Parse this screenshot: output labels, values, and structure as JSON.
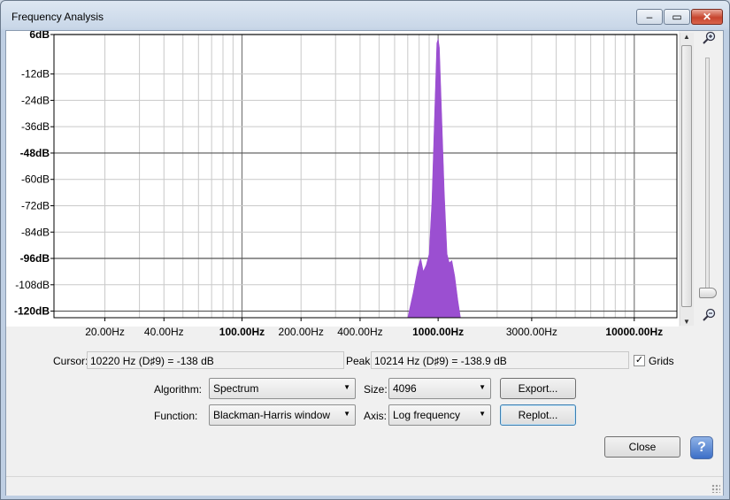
{
  "window": {
    "title": "Frequency Analysis"
  },
  "titlebar_buttons": {
    "minimize": "–",
    "maximize": "▭",
    "close": "✕"
  },
  "chart_data": {
    "type": "area",
    "title": "",
    "xlabel": "",
    "ylabel": "",
    "x_scale": "log",
    "xlim": [
      11,
      16500
    ],
    "ylim": [
      -123,
      6
    ],
    "grid": true,
    "y_ticks": [
      {
        "value": 6,
        "label": "6dB",
        "bold": true
      },
      {
        "value": -12,
        "label": "-12dB",
        "bold": false
      },
      {
        "value": -24,
        "label": "-24dB",
        "bold": false
      },
      {
        "value": -36,
        "label": "-36dB",
        "bold": false
      },
      {
        "value": -48,
        "label": "-48dB",
        "bold": true
      },
      {
        "value": -60,
        "label": "-60dB",
        "bold": false
      },
      {
        "value": -72,
        "label": "-72dB",
        "bold": false
      },
      {
        "value": -84,
        "label": "-84dB",
        "bold": false
      },
      {
        "value": -96,
        "label": "-96dB",
        "bold": true
      },
      {
        "value": -108,
        "label": "-108dB",
        "bold": false
      },
      {
        "value": -120,
        "label": "-120dB",
        "bold": true
      }
    ],
    "x_ticks": [
      {
        "value": 20,
        "label": "20.00Hz",
        "bold": false
      },
      {
        "value": 40,
        "label": "40.00Hz",
        "bold": false
      },
      {
        "value": 100,
        "label": "100.00Hz",
        "bold": true
      },
      {
        "value": 200,
        "label": "200.00Hz",
        "bold": false
      },
      {
        "value": 400,
        "label": "400.00Hz",
        "bold": false
      },
      {
        "value": 1000,
        "label": "1000.00Hz",
        "bold": true
      },
      {
        "value": 3000,
        "label": "3000.00Hz",
        "bold": false
      },
      {
        "value": 10000,
        "label": "10000.00Hz",
        "bold": true
      }
    ],
    "series": [
      {
        "color": "#9b4fd1",
        "points": [
          [
            700,
            -124
          ],
          [
            745,
            -112
          ],
          [
            790,
            -100
          ],
          [
            815,
            -96
          ],
          [
            840,
            -102
          ],
          [
            870,
            -99
          ],
          [
            900,
            -94
          ],
          [
            930,
            -70
          ],
          [
            960,
            -30
          ],
          [
            985,
            2
          ],
          [
            1000,
            4
          ],
          [
            1015,
            0
          ],
          [
            1040,
            -28
          ],
          [
            1075,
            -66
          ],
          [
            1110,
            -94
          ],
          [
            1140,
            -98
          ],
          [
            1175,
            -97
          ],
          [
            1215,
            -104
          ],
          [
            1260,
            -115
          ],
          [
            1300,
            -124
          ]
        ]
      }
    ]
  },
  "cursor": {
    "label": "Cursor:",
    "value": "10220 Hz (D♯9) = -138 dB"
  },
  "peak": {
    "label": "Peak:",
    "value": "10214 Hz (D♯9) = -138.9 dB"
  },
  "grids": {
    "label": "Grids",
    "checked": "✓"
  },
  "algorithm": {
    "label": "Algorithm:",
    "value": "Spectrum"
  },
  "function": {
    "label": "Function:",
    "value": "Blackman-Harris window"
  },
  "size": {
    "label": "Size:",
    "value": "4096"
  },
  "axis": {
    "label": "Axis:",
    "value": "Log frequency"
  },
  "buttons": {
    "export": "Export...",
    "replot": "Replot...",
    "close": "Close",
    "help": "?"
  },
  "dropdown_arrow": "▼"
}
